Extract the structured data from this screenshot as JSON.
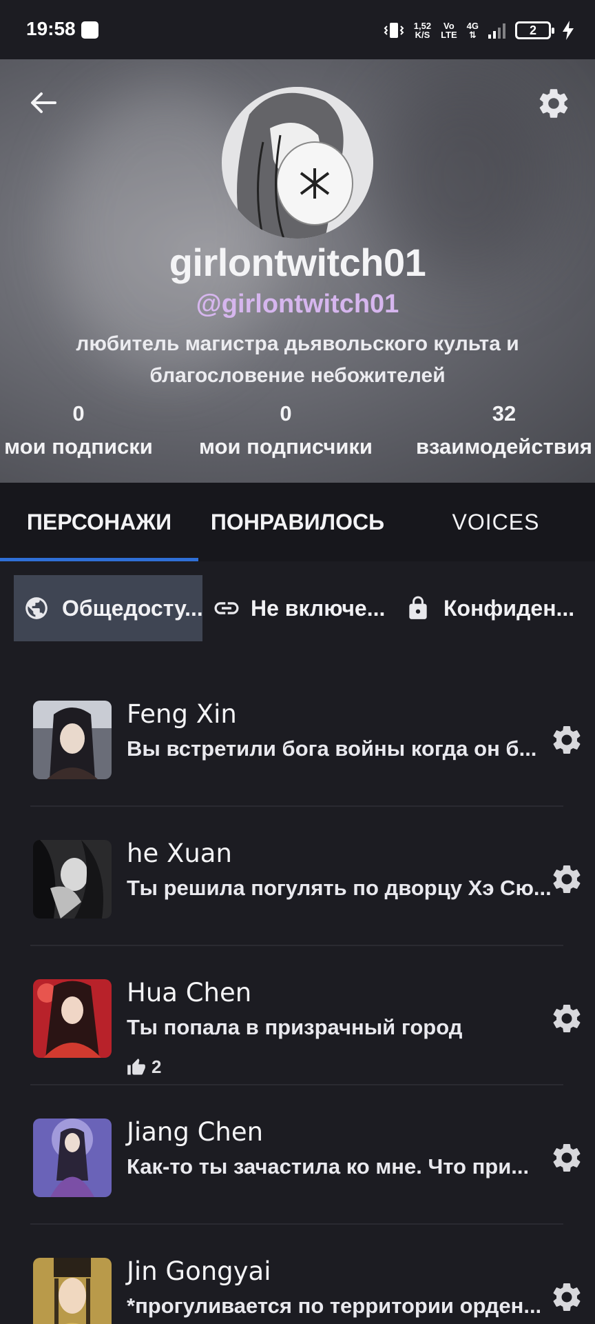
{
  "status_bar": {
    "time": "19:58",
    "net_speed": "1,52",
    "net_unit": "K/S",
    "volte_top": "Vo",
    "volte_bottom": "LTE",
    "network": "4G",
    "battery": "2"
  },
  "profile": {
    "display_name": "girlontwitch01",
    "handle": "@girlontwitch01",
    "bio": "любитель магистра дьявольского культа и благословение небожителей",
    "stats": [
      {
        "value": "0",
        "label": "мои подписки"
      },
      {
        "value": "0",
        "label": "мои подписчики"
      },
      {
        "value": "32",
        "label": "взаимодействия"
      }
    ]
  },
  "tabs": [
    {
      "label": "ПЕРСОНАЖИ",
      "active": true
    },
    {
      "label": "ПОНРАВИЛОСЬ",
      "active": false
    },
    {
      "label": "VOICES",
      "active": false
    }
  ],
  "filters": [
    {
      "label": "Общедосту...",
      "icon": "globe-icon",
      "active": true
    },
    {
      "label": "Не включе...",
      "icon": "link-icon",
      "active": false
    },
    {
      "label": "Конфиден...",
      "icon": "lock-icon",
      "active": false
    }
  ],
  "characters": [
    {
      "name": "Feng Xin",
      "description": "Вы встретили бога войны когда он б...",
      "likes": null
    },
    {
      "name": "he Xuan",
      "description": "Ты решила погулять по дворцу Хэ Сю...",
      "likes": null
    },
    {
      "name": "Hua Chen",
      "description": "Ты попала в призрачный город",
      "likes": "2"
    },
    {
      "name": "Jiang Chen",
      "description": "Как-то ты зачастила ко мне. Что при...",
      "likes": null
    },
    {
      "name": "Jin Gongyai",
      "description": "*прогуливается по территории орден...",
      "likes": null
    }
  ],
  "colors": {
    "background": "#1c1c22",
    "handle": "#d6b6ee",
    "tab_indicator": "#2f6fd6",
    "filter_active": "#3f4553"
  }
}
